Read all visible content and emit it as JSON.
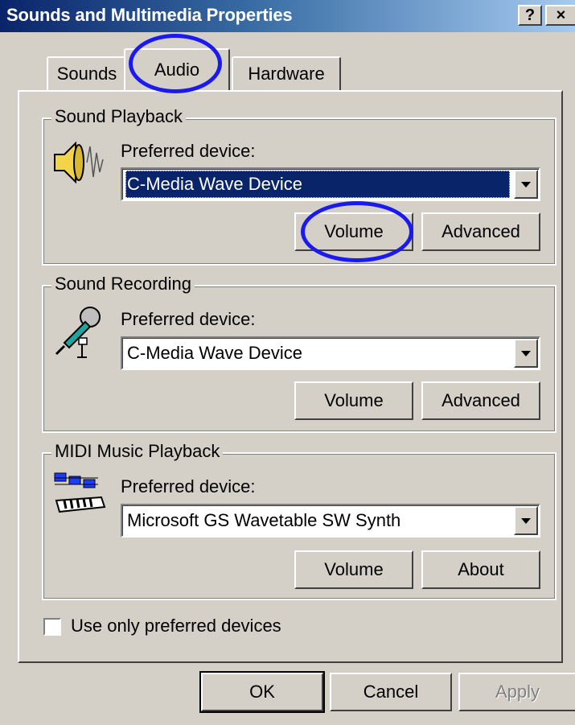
{
  "window": {
    "title": "Sounds and Multimedia Properties"
  },
  "caption_buttons": {
    "help": "?",
    "close": "×"
  },
  "tabs": [
    {
      "label": "Sounds"
    },
    {
      "label": "Audio"
    },
    {
      "label": "Hardware"
    }
  ],
  "sections": [
    {
      "title": "Sound Playback",
      "icon": "speaker-icon",
      "preferred_label": "Preferred device:",
      "device": "C-Media Wave Device",
      "buttons": [
        "Volume",
        "Advanced"
      ]
    },
    {
      "title": "Sound Recording",
      "icon": "microphone-icon",
      "preferred_label": "Preferred device:",
      "device": "C-Media Wave Device",
      "buttons": [
        "Volume",
        "Advanced"
      ]
    },
    {
      "title": "MIDI Music Playback",
      "icon": "midi-keyboard-icon",
      "preferred_label": "Preferred device:",
      "device": "Microsoft GS Wavetable SW Synth",
      "buttons": [
        "Volume",
        "About"
      ]
    }
  ],
  "checkbox": {
    "label": "Use only preferred devices",
    "checked": false
  },
  "footer_buttons": {
    "ok": "OK",
    "cancel": "Cancel",
    "apply": "Apply"
  },
  "colors": {
    "highlight": "#0a246a",
    "annotation_circle": "#1a1af0",
    "face": "#d4d0c8"
  }
}
